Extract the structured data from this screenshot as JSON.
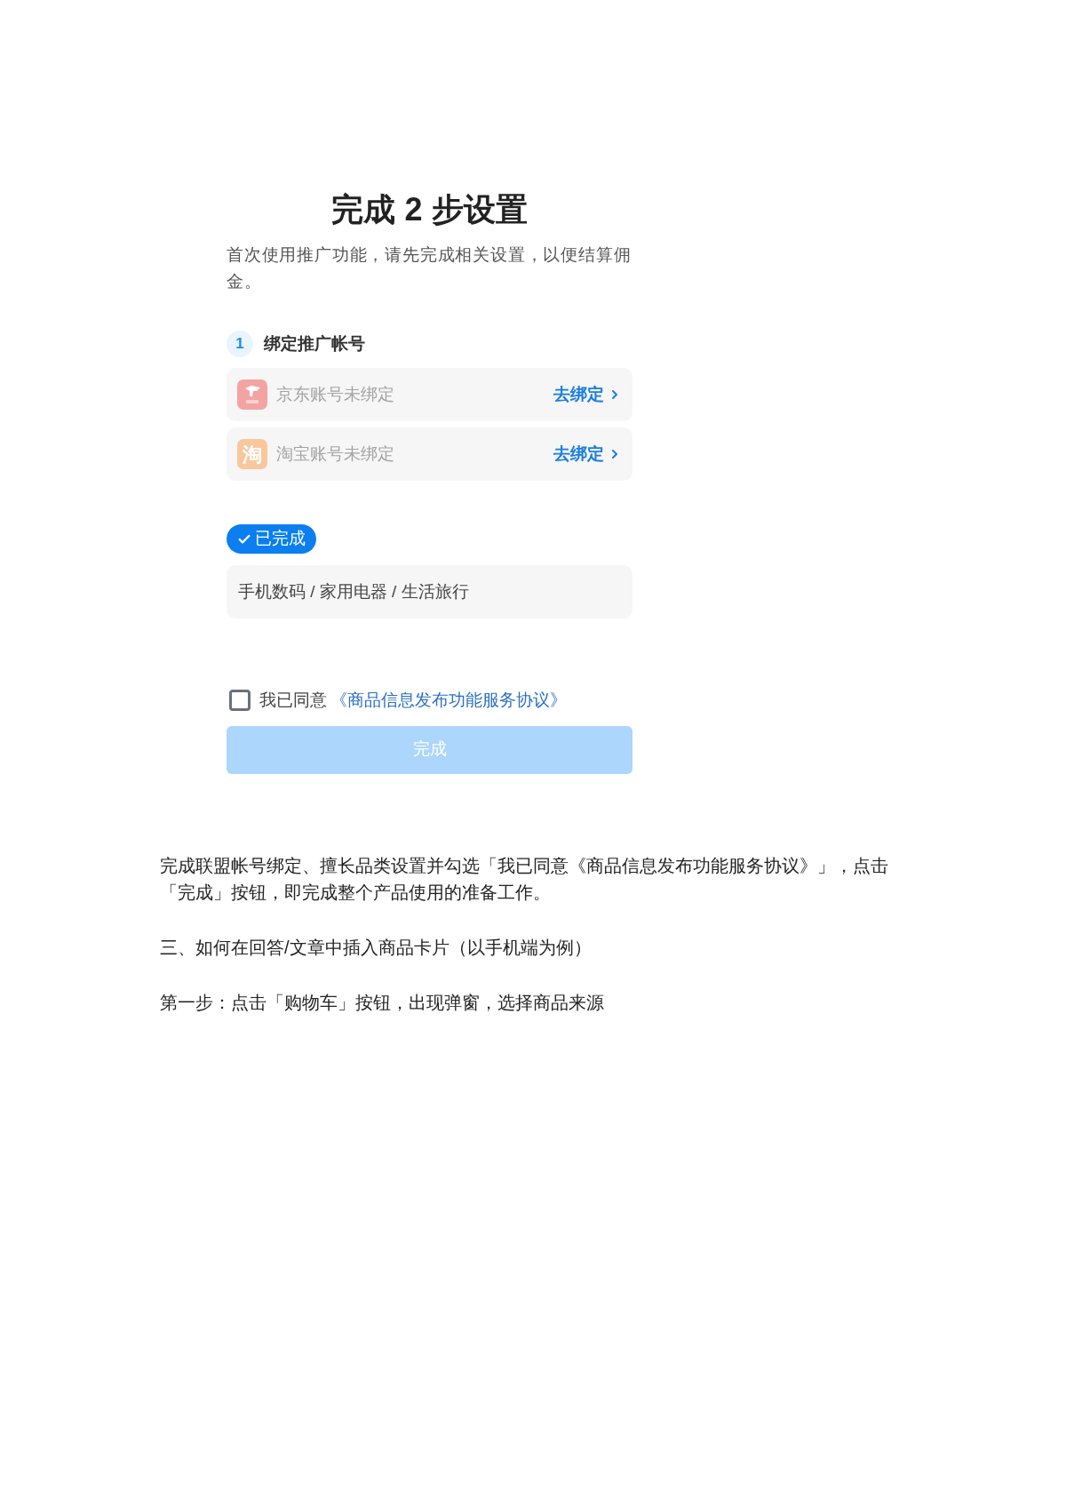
{
  "setup": {
    "title": "完成 2 步设置",
    "intro": "首次使用推广功能，请先完成相关设置，以便结算佣金。",
    "step": {
      "number": "1",
      "label": "绑定推广帐号"
    },
    "accounts": [
      {
        "kind": "jd",
        "status": "京东账号未绑定",
        "action": "去绑定"
      },
      {
        "kind": "taobao",
        "logo_text": "淘",
        "status": "淘宝账号未绑定",
        "action": "去绑定"
      }
    ],
    "badge": {
      "label": "已完成",
      "done": true
    },
    "categories": "手机数码 / 家用电器 / 生活旅行",
    "agreement": {
      "checked": false,
      "prefix": "我已同意",
      "link": "《商品信息发布功能服务协议》"
    },
    "submit": {
      "label": "完成",
      "disabled": true
    }
  },
  "article": [
    "完成联盟帐号绑定、擅长品类设置并勾选「我已同意《商品信息发布功能服务协议》」，点击「完成」按钮，即完成整个产品使用的准备工作。",
    "三、如何在回答/文章中插入商品卡片（以手机端为例）",
    "第一步：点击「购物车」按钮，出现弹窗，选择商品来源"
  ]
}
